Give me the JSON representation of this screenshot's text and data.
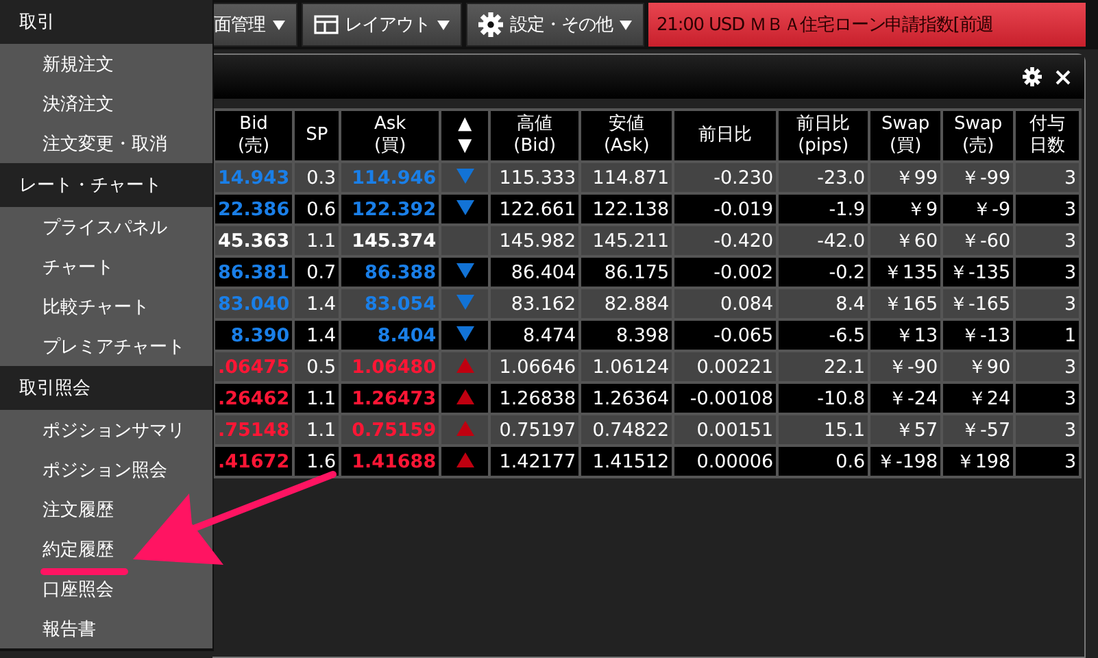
{
  "toolbar": {
    "buttons": [
      {
        "kind": "plain",
        "label": "面管理"
      },
      {
        "kind": "layout",
        "label": "レイアウト"
      },
      {
        "kind": "gear",
        "label": "設定・その他"
      }
    ],
    "ticker": "21:00  USD  ＭＢＡ住宅ローン申請指数[前週"
  },
  "table": {
    "columns": [
      {
        "lines": [
          "Bid",
          "(売)"
        ]
      },
      {
        "lines": [
          "SP"
        ]
      },
      {
        "lines": [
          "Ask",
          "(買)"
        ]
      },
      {
        "lines": [
          "▲",
          "▼"
        ]
      },
      {
        "lines": [
          "高値",
          "(Bid)"
        ]
      },
      {
        "lines": [
          "安値",
          "(Ask)"
        ]
      },
      {
        "lines": [
          "前日比"
        ]
      },
      {
        "lines": [
          "前日比",
          "(pips)"
        ]
      },
      {
        "lines": [
          "Swap",
          "(買)"
        ]
      },
      {
        "lines": [
          "Swap",
          "(売)"
        ]
      },
      {
        "lines": [
          "付与",
          "日数"
        ]
      }
    ],
    "rows": [
      {
        "rising": false,
        "falling": true,
        "cells": [
          "14.943",
          "0.3",
          "114.946",
          "",
          "115.333",
          "114.871",
          "-0.230",
          "-23.0",
          "￥99",
          "￥-99",
          "3"
        ]
      },
      {
        "rising": false,
        "falling": true,
        "cells": [
          "22.386",
          "0.6",
          "122.392",
          "",
          "122.661",
          "122.138",
          "-0.019",
          "-1.9",
          "￥9",
          "￥-9",
          "3"
        ]
      },
      {
        "rising": false,
        "falling": false,
        "cells": [
          "45.363",
          "1.1",
          "145.374",
          "",
          "145.982",
          "145.211",
          "-0.420",
          "-42.0",
          "￥60",
          "￥-60",
          "3"
        ]
      },
      {
        "rising": false,
        "falling": true,
        "cells": [
          "86.381",
          "0.7",
          "86.388",
          "",
          "86.404",
          "86.175",
          "-0.002",
          "-0.2",
          "￥135",
          "￥-135",
          "3"
        ]
      },
      {
        "rising": false,
        "falling": true,
        "cells": [
          "83.040",
          "1.4",
          "83.054",
          "",
          "83.162",
          "82.884",
          "0.084",
          "8.4",
          "￥165",
          "￥-165",
          "3"
        ]
      },
      {
        "rising": false,
        "falling": true,
        "cells": [
          "8.390",
          "1.4",
          "8.404",
          "",
          "8.474",
          "8.398",
          "-0.065",
          "-6.5",
          "￥13",
          "￥-13",
          "1"
        ]
      },
      {
        "rising": true,
        "falling": false,
        "cells": [
          ".06475",
          "0.5",
          "1.06480",
          "",
          "1.06646",
          "1.06124",
          "0.00221",
          "22.1",
          "￥-90",
          "￥90",
          "3"
        ]
      },
      {
        "rising": true,
        "falling": false,
        "cells": [
          ".26462",
          "1.1",
          "1.26473",
          "",
          "1.26838",
          "1.26364",
          "-0.00108",
          "-10.8",
          "￥-24",
          "￥24",
          "3"
        ]
      },
      {
        "rising": true,
        "falling": false,
        "cells": [
          ".75148",
          "1.1",
          "0.75159",
          "",
          "0.75197",
          "0.74822",
          "0.00151",
          "15.1",
          "￥57",
          "￥-57",
          "3"
        ]
      },
      {
        "rising": true,
        "falling": false,
        "cells": [
          ".41672",
          "1.6",
          "1.41688",
          "",
          "1.42177",
          "1.41512",
          "0.00006",
          "0.6",
          "￥-198",
          "￥198",
          "3"
        ]
      }
    ]
  },
  "menu": [
    {
      "title": "取引",
      "items": [
        {
          "label": "新規注文"
        },
        {
          "label": "決済注文"
        },
        {
          "label": "注文変更・取消"
        }
      ]
    },
    {
      "title": "レート・チャート",
      "items": [
        {
          "label": "プライスパネル"
        },
        {
          "label": "チャート"
        },
        {
          "label": "比較チャート"
        },
        {
          "label": "プレミアチャート"
        }
      ]
    },
    {
      "title": "取引照会",
      "items": [
        {
          "label": "ポジションサマリ"
        },
        {
          "label": "ポジション照会"
        },
        {
          "label": "注文履歴"
        },
        {
          "label": "約定履歴"
        },
        {
          "label": "口座照会"
        },
        {
          "label": "報告書"
        }
      ]
    }
  ]
}
